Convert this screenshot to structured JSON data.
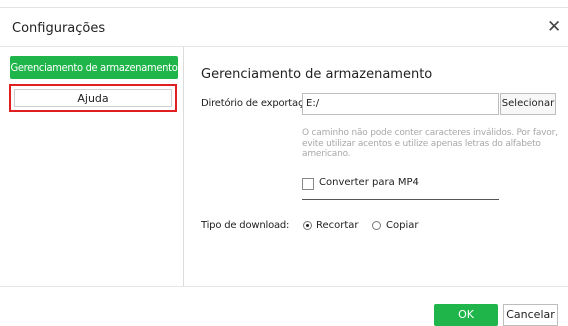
{
  "dialog": {
    "title": "Configurações",
    "close_glyph": "✕"
  },
  "sidebar": {
    "items": [
      {
        "label": "Gerenciamento de armazenamento",
        "active": true
      },
      {
        "label": "Ajuda",
        "active": false,
        "highlighted": true
      }
    ],
    "active_color": "#1fb54a",
    "highlight_color": "#e02020"
  },
  "storage": {
    "title": "Gerenciamento de armazenamento",
    "export_dir_label": "Diretório de exportação:",
    "export_dir_value": "E:/",
    "select_button": "Selecionar",
    "hint": "O caminho não pode conter caracteres inválidos. Por favor, evite utilizar acentos e utilize apenas letras do alfabeto americano.",
    "convert_mp4_label": "Converter para MP4",
    "convert_mp4_checked": false,
    "download_type_label": "Tipo de download:",
    "download_options": [
      {
        "label": "Recortar",
        "selected": true
      },
      {
        "label": "Copiar",
        "selected": false
      }
    ]
  },
  "footer": {
    "ok": "OK",
    "cancel": "Cancelar"
  }
}
